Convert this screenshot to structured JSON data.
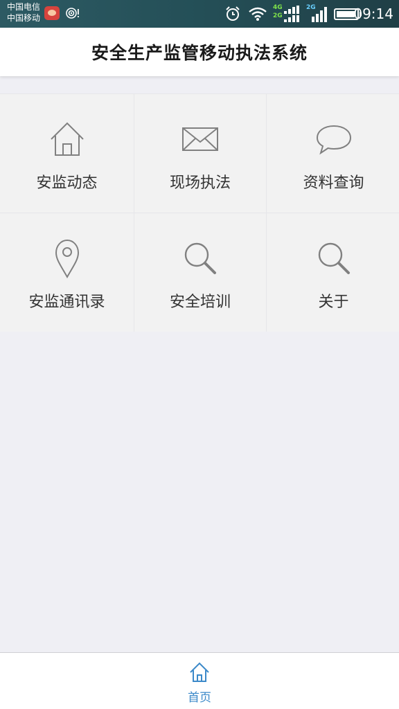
{
  "status_bar": {
    "carrier_1": "中国电信",
    "carrier_2": "中国移动",
    "network_1_top": "4G",
    "network_1_bottom": "2G",
    "network_2": "2G",
    "time": "09:14",
    "icons": [
      "weibo-icon",
      "hotspot-icon",
      "alarm-icon",
      "wifi-icon",
      "signal-icon",
      "battery-icon"
    ]
  },
  "header": {
    "title": "安全生产监管移动执法系统"
  },
  "menu": {
    "items": [
      {
        "label": "安监动态",
        "icon": "home-icon"
      },
      {
        "label": "现场执法",
        "icon": "mail-icon"
      },
      {
        "label": "资料查询",
        "icon": "chat-bubble-icon"
      },
      {
        "label": "安监通讯录",
        "icon": "location-pin-icon"
      },
      {
        "label": "安全培训",
        "icon": "search-icon"
      },
      {
        "label": "关于",
        "icon": "search-icon"
      }
    ]
  },
  "bottom_nav": {
    "home_label": "首页",
    "home_icon": "home-icon",
    "active_color": "#3b89c9"
  },
  "colors": {
    "status_bar": "#244f57",
    "background": "#efeff4",
    "tile": "#f2f2f2",
    "icon_stroke": "#808080"
  }
}
